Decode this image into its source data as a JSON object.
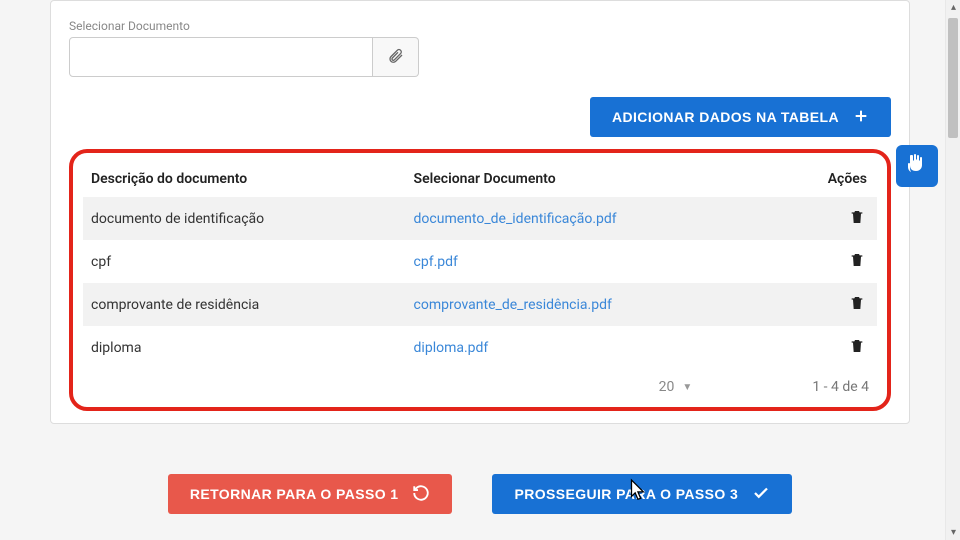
{
  "form": {
    "select_doc_label": "Selecionar Documento",
    "select_doc_value": ""
  },
  "buttons": {
    "add_table": "ADICIONAR DADOS NA TABELA",
    "back_step1": "RETORNAR PARA O PASSO 1",
    "next_step3": "PROSSEGUIR PARA O PASSO 3"
  },
  "table": {
    "headers": {
      "desc": "Descrição do documento",
      "doc": "Selecionar Documento",
      "actions": "Ações"
    },
    "rows": [
      {
        "desc": "documento de identificação",
        "file": "documento_de_identificação.pdf"
      },
      {
        "desc": "cpf",
        "file": "cpf.pdf"
      },
      {
        "desc": "comprovante de residência",
        "file": "comprovante_de_residência.pdf"
      },
      {
        "desc": "diploma",
        "file": "diploma.pdf"
      }
    ],
    "pager": {
      "page_size": "20",
      "range": "1 - 4 de 4"
    }
  }
}
